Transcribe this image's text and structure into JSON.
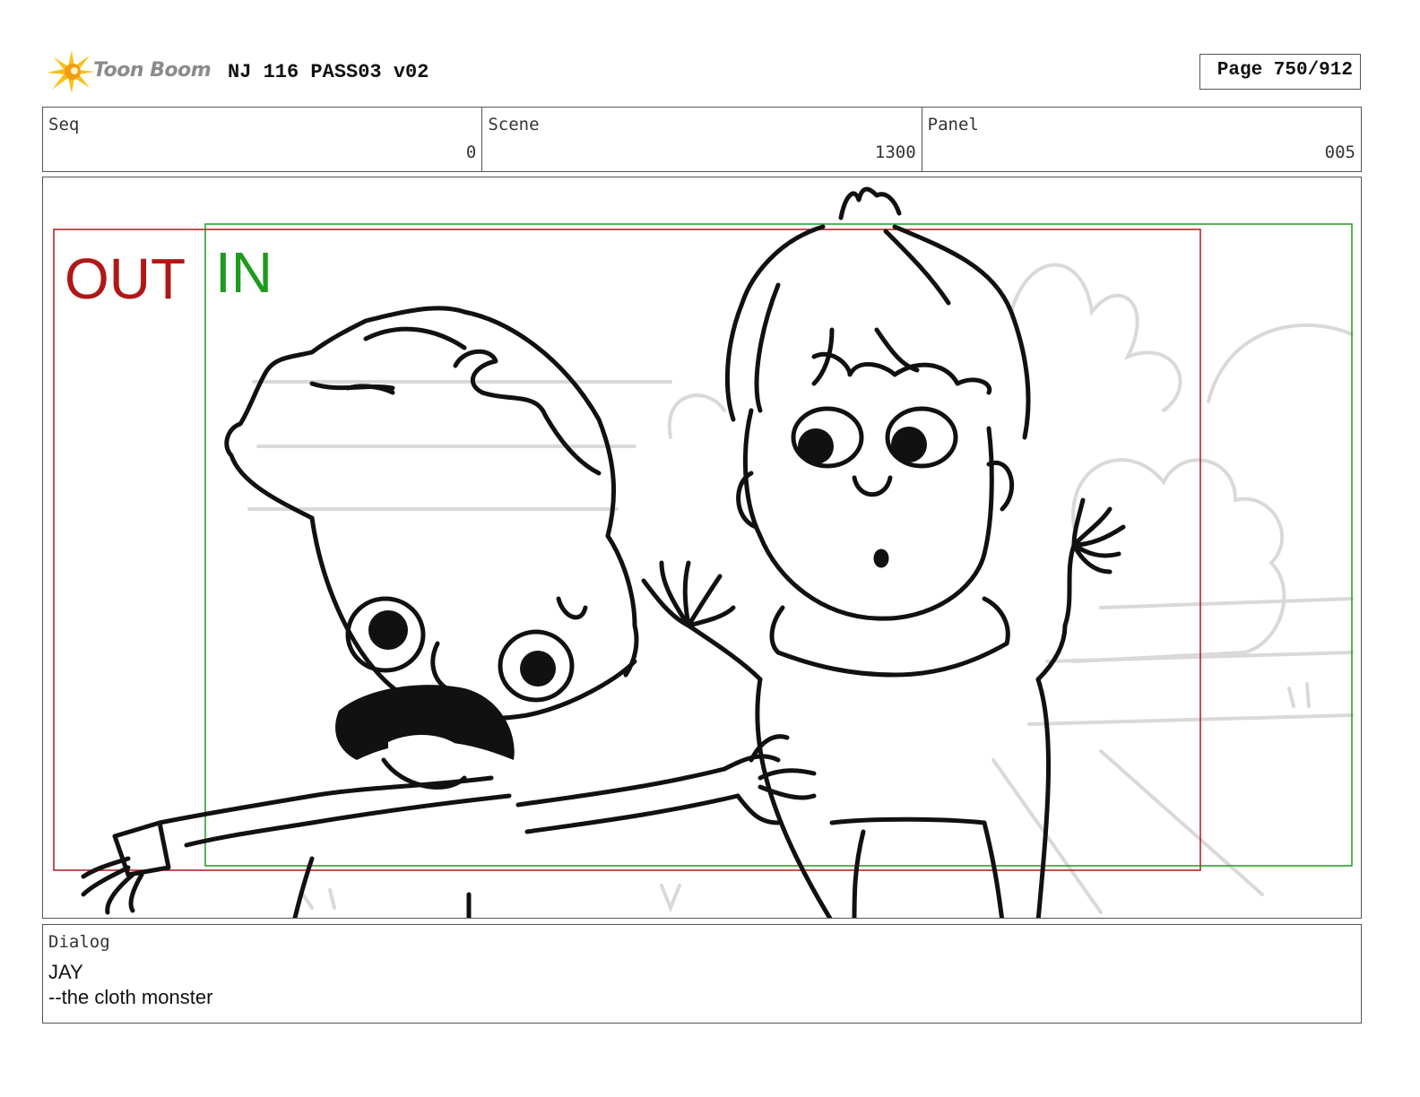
{
  "header": {
    "logo_text": "Toon Boom",
    "project_title": "NJ 116 PASS03 v02",
    "page_label": "Page 750/912"
  },
  "info": {
    "seq": {
      "label": "Seq",
      "value": "0"
    },
    "scene": {
      "label": "Scene",
      "value": "1300"
    },
    "panel": {
      "label": "Panel",
      "value": "005"
    }
  },
  "frame": {
    "out_label": "OUT",
    "in_label": "IN",
    "out_color": "#b01818",
    "in_color": "#1e9a1e"
  },
  "dialog": {
    "label": "Dialog",
    "speaker": "JAY",
    "line": "--the cloth monster"
  },
  "icons": {
    "logo": "toon-boom-star-icon"
  }
}
